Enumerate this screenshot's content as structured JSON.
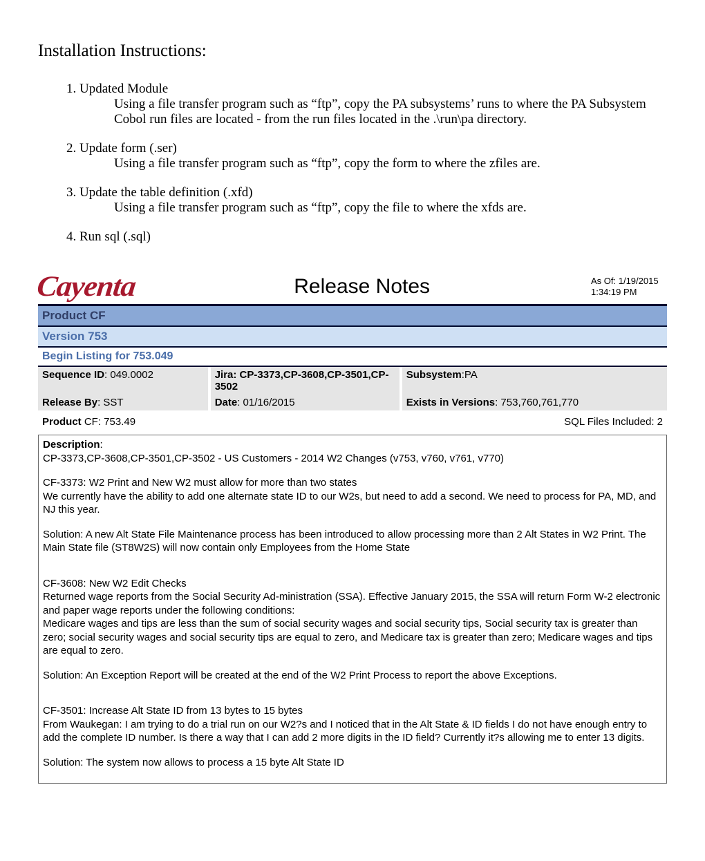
{
  "install": {
    "heading": "Installation Instructions:",
    "items": [
      {
        "title": "Updated Module",
        "body": "Using a file transfer program such as “ftp”, copy the PA subsystems’ runs to where the PA Subsystem Cobol run files are located - from the run files located in the .\\run\\pa directory."
      },
      {
        "title": "Update form (.ser)",
        "body": "Using a file transfer program such as “ftp”, copy the form to where the zfiles are."
      },
      {
        "title": "Update the table definition (.xfd)",
        "body": "Using a file transfer program such as “ftp”, copy the file to where the xfds are."
      },
      {
        "title": "Run sql (.sql)",
        "body": ""
      }
    ]
  },
  "header": {
    "logo": "Cayenta",
    "title": "Release Notes",
    "asof_label": "As Of: ",
    "asof_date": "1/19/2015",
    "asof_time": "1:34:19 PM"
  },
  "banners": {
    "product": "Product CF",
    "version": "Version 753",
    "begin": "Begin Listing for 753.049"
  },
  "meta": {
    "seq_label": "Sequence ID",
    "seq_value": ": 049.0002",
    "jira_label": "Jira: ",
    "jira_value": "CP-3373,CP-3608,CP-3501,CP-3502",
    "subsystem_label": "Subsystem",
    "subsystem_value": ":PA",
    "release_label": "Release By",
    "release_value": ": SST",
    "date_label": "Date",
    "date_value": ": 01/16/2015",
    "exists_label": "Exists in Versions",
    "exists_value": ": 753,760,761,770"
  },
  "product": {
    "label": "Product",
    "value": " CF: 753.49",
    "sql": "SQL Files Included: 2"
  },
  "desc": {
    "label": "Description",
    "line1": "CP-3373,CP-3608,CP-3501,CP-3502 - US Customers - 2014 W2 Changes (v753, v760, v761, v770)",
    "cf3373_title": "CF-3373: W2 Print and New W2 must allow for more than two states",
    "cf3373_body": "We currently have the ability to add one alternate state ID to our W2s, but need to add a second. We need to process for PA, MD, and NJ this year.",
    "cf3373_sol": "Solution: A new Alt State File Maintenance process has been introduced to allow processing more than 2 Alt States in W2 Print. The Main State file (ST8W2S) will now contain only Employees from the Home State",
    "cf3608_title": "CF-3608: New W2 Edit Checks",
    "cf3608_body": "Returned wage reports from the Social Security Ad-ministration (SSA). Effective January 2015, the SSA will return Form W-2 electronic and paper wage reports under the following conditions:",
    "cf3608_body2": "Medicare wages and tips are less than the sum of social security wages and social security tips, Social security tax is greater than zero; social security wages and social security tips are equal to zero, and Medicare tax is greater than zero; Medicare wages and tips are equal to zero.",
    "cf3608_sol": "Solution: An Exception Report will be created at the end of the W2 Print Process to report the above Exceptions.",
    "cf3501_title": "CF-3501: Increase Alt State ID from 13 bytes to 15 bytes",
    "cf3501_body": "From Waukegan: I am trying to do a trial run on our W2?s and I noticed that in the Alt State & ID fields I do not have enough entry to add the complete ID number. Is there a way that I can add 2 more digits in the ID field? Currently it?s allowing me to enter 13 digits.",
    "cf3501_sol": "Solution: The system now allows to process a 15 byte Alt State ID"
  }
}
